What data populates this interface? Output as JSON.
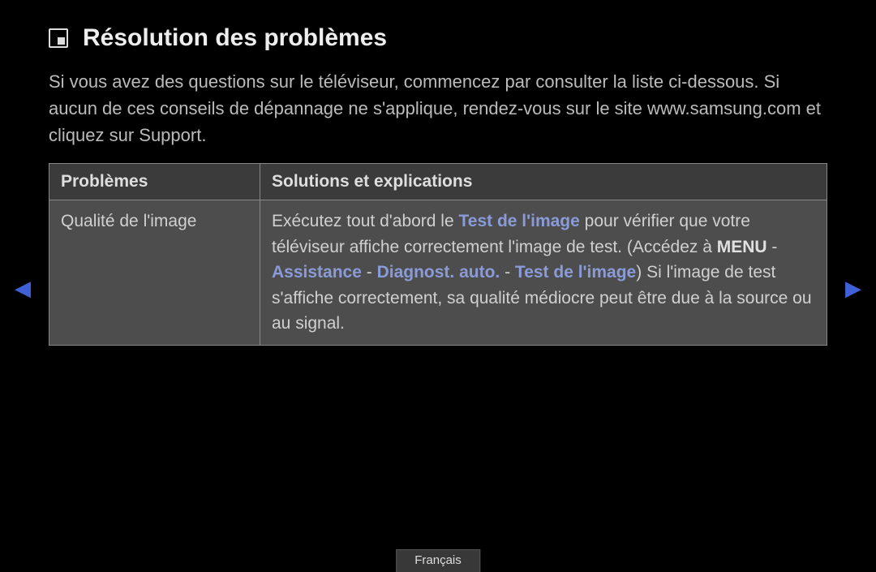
{
  "title": "Résolution des problèmes",
  "intro": "Si vous avez des questions sur le téléviseur, commencez par consulter la liste ci-dessous. Si aucun de ces conseils de dépannage ne s'applique, rendez-vous sur le site www.samsung.com et cliquez sur Support.",
  "table": {
    "headers": {
      "problems": "Problèmes",
      "solutions": "Solutions et explications"
    },
    "row": {
      "problem": "Qualité de l'image",
      "solution_parts": {
        "p1": "Exécutez tout d'abord le ",
        "p2_blue": "Test de l'image",
        "p3": " pour vérifier que votre téléviseur affiche correctement l'image de test. (Accédez à ",
        "p4_bold": "MENU",
        "p5": " - ",
        "p6_blue": "Assistance",
        "p7": " - ",
        "p8_blue": "Diagnost. auto.",
        "p9": " - ",
        "p10_blue": "Test de l'image",
        "p11": ") Si l'image de test s'affiche correctement, sa qualité médiocre peut être due à la source ou au signal."
      }
    }
  },
  "nav": {
    "left": "◀",
    "right": "▶"
  },
  "language": "Français"
}
